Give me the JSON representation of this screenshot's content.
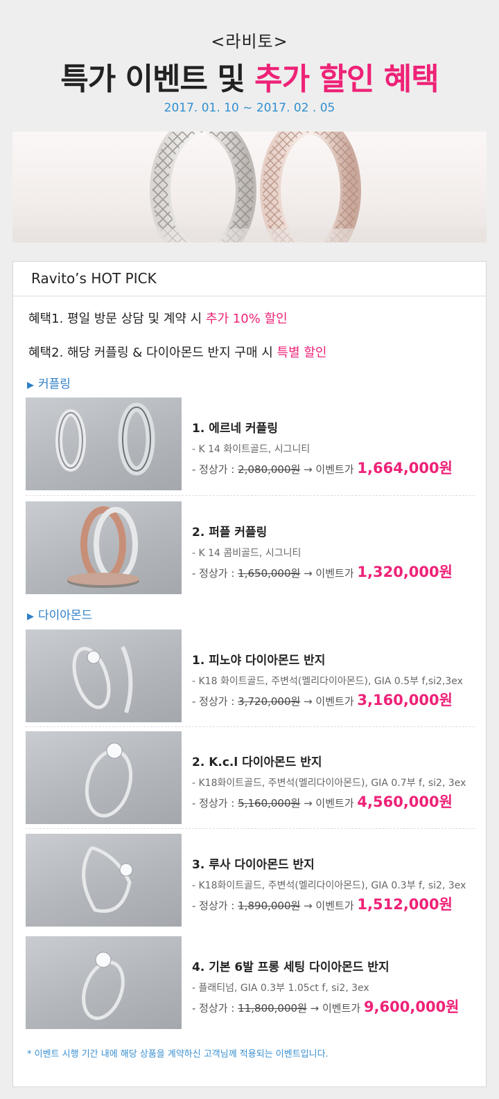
{
  "header": {
    "brand": "<라비토>",
    "headline_dark": "특가 이벤트 및 ",
    "headline_pink": "추가 할인 혜택",
    "period": "2017. 01. 10 ~ 2017. 02 . 05"
  },
  "card": {
    "title": "Ravito’s HOT PICK",
    "benefit1_prefix": "혜택1.  평일 방문 상담 및 계약 시 ",
    "benefit1_highlight": "추가 10% 할인",
    "benefit2_prefix": "혜택2.  해당 커플링 & 다이아몬드 반지 구매 시 ",
    "benefit2_highlight": "특별 할인",
    "section_couple": "커플링",
    "section_diamond": "다이아몬드",
    "section_marker": "▶",
    "footnote": "* 이벤트 시행 기간 내에 해당 상품을 계약하신 고객님께 적용되는 이벤트입니다."
  },
  "price_prefix": "- 정상가 : ",
  "price_arrow": " → 이벤트가 ",
  "products": [
    {
      "name": "1. 에르네 커플링",
      "spec": "- K 14 화이트골드, 시그니티",
      "orig": "2,080,000원",
      "event": "1,664,000원"
    },
    {
      "name": "2. 퍼플 커플링",
      "spec": "- K 14 콤비골드, 시그니티",
      "orig": "1,650,000원",
      "event": "1,320,000원"
    },
    {
      "name": "1. 피노야 다이아몬드 반지",
      "spec": "- K18 화이트골드, 주변석(멜리다이아몬드), GIA 0.5부 f,si2,3ex",
      "orig": "3,720,000원",
      "event": "3,160,000원"
    },
    {
      "name": "2. K.c.l 다이아몬드 반지",
      "spec": "- K18화이트골드, 주변석(멜리다이아몬드), GIA 0.7부 f, si2, 3ex",
      "orig": "5,160,000원",
      "event": "4,560,000원"
    },
    {
      "name": "3. 루사 다이아몬드 반지",
      "spec": "- K18화이트골드, 주변석(멜리다이아몬드), GIA 0.3부 f, si2, 3ex",
      "orig": "1,890,000원",
      "event": "1,512,000원"
    },
    {
      "name": "4. 기본 6발 프롱 세팅 다이아몬드 반지",
      "spec": "- 플래티넘, GIA 0.3부 1.05ct f, si2, 3ex",
      "orig": "11,800,000원",
      "event": "9,600,000원"
    }
  ],
  "colors": {
    "accent_pink": "#ee2277",
    "accent_blue": "#2f8fcf",
    "page_bg": "#eeeeee"
  }
}
